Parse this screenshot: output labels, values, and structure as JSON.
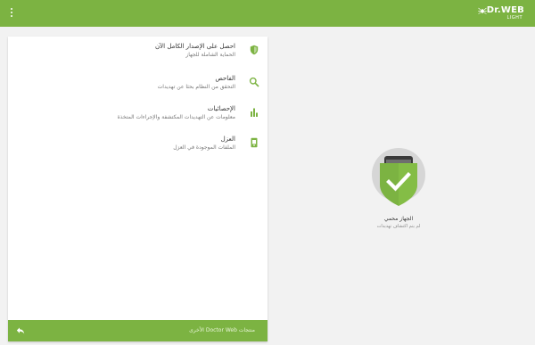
{
  "header": {
    "menu_icon": "more-vert-icon",
    "logo_text": "Dr.WEB",
    "logo_subtext": "LIGHT",
    "background": "#7cb342"
  },
  "menu": {
    "items": [
      {
        "icon": "shield-icon",
        "title": "احصل على الإصدار الكامل الآن",
        "subtitle": "الحماية الشاملة للجهاز"
      },
      {
        "icon": "search-icon",
        "title": "الفاحص",
        "subtitle": "التحقق من النظام بحثا عن تهديدات"
      },
      {
        "icon": "bar-chart-icon",
        "title": "الإحصائيات",
        "subtitle": "معلومات عن التهديدات المكتشفة والإجراءات المتخذة"
      },
      {
        "icon": "quarantine-icon",
        "title": "العزل",
        "subtitle": "الملفات الموجودة في العزل"
      }
    ]
  },
  "footer": {
    "label": "منتجات Doctor Web الأخرى",
    "back_icon": "reply-arrow-icon"
  },
  "status": {
    "title": "الجهاز محمي",
    "subtitle": "لم يتم اكتشاف تهديدات",
    "icon": "protected-shield-check-icon",
    "accent": "#7cb342"
  }
}
